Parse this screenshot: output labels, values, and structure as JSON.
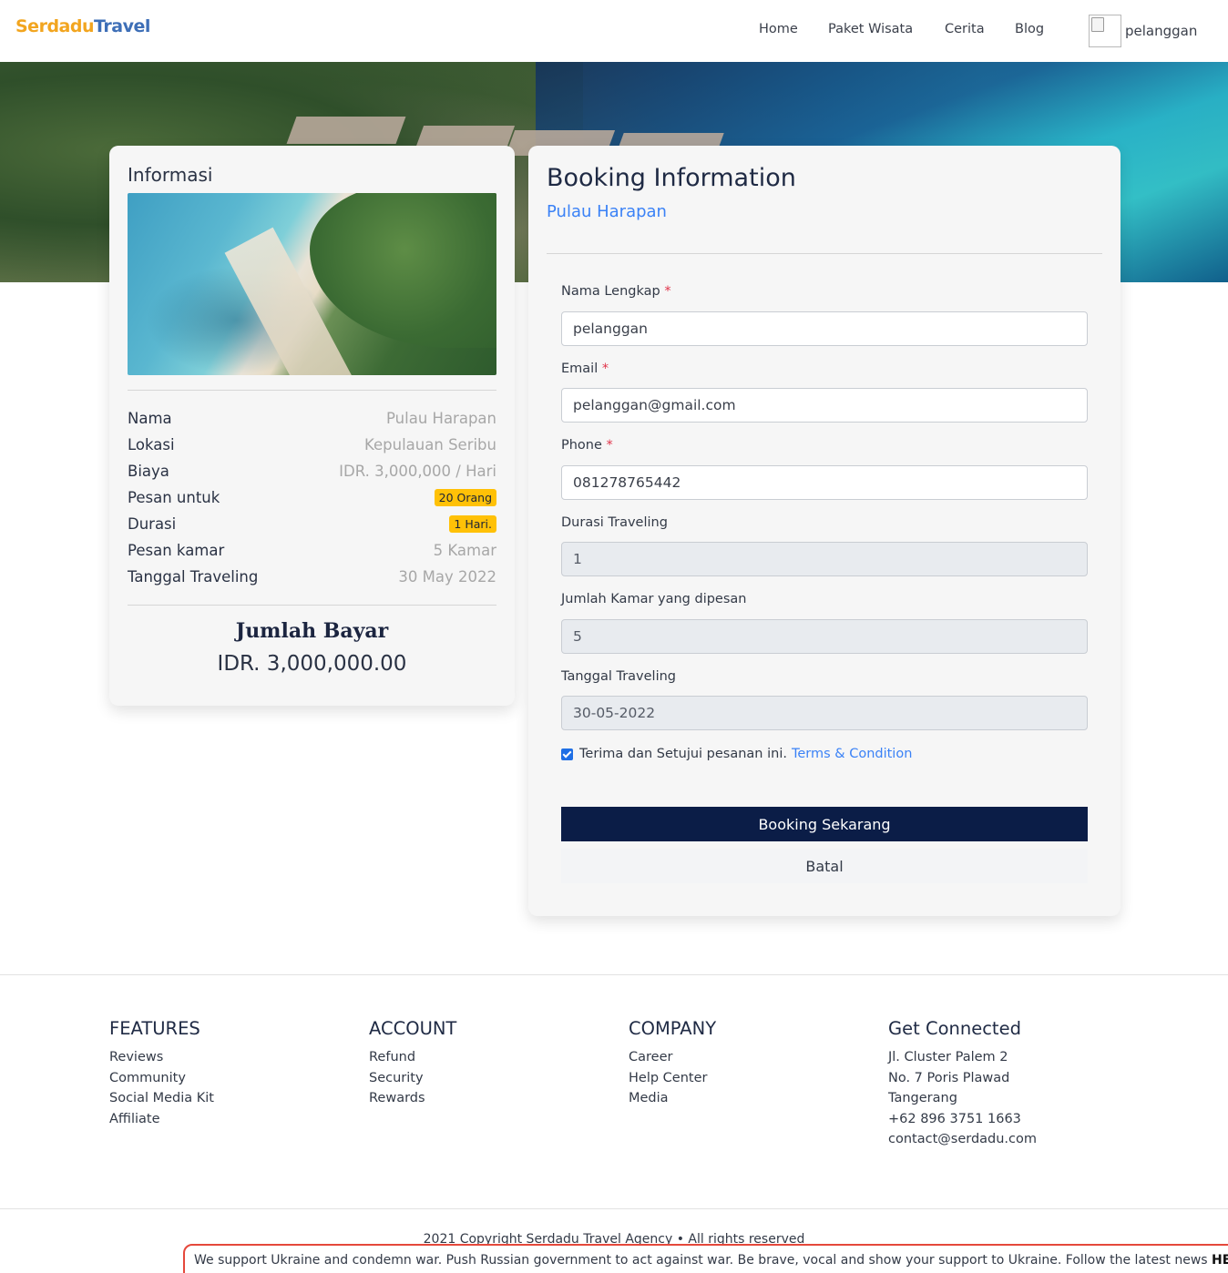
{
  "brand": {
    "part1": "Serdadu",
    "part2": "Travel"
  },
  "nav": {
    "links": [
      "Home",
      "Paket Wisata",
      "Cerita",
      "Blog"
    ],
    "user": "pelanggan"
  },
  "info": {
    "title": "Informasi",
    "rows": [
      {
        "label": "Nama",
        "value": "Pulau Harapan"
      },
      {
        "label": "Lokasi",
        "value": "Kepulauan Seribu"
      },
      {
        "label": "Biaya",
        "value": "IDR. 3,000,000 / Hari"
      },
      {
        "label": "Pesan untuk",
        "value": "20 Orang"
      },
      {
        "label": "Durasi",
        "value": "1 Hari."
      },
      {
        "label": "Pesan kamar",
        "value": "5 Kamar"
      },
      {
        "label": "Tanggal Traveling",
        "value": "30 May 2022"
      }
    ],
    "pay_title": "Jumlah Bayar",
    "pay_amount": "IDR. 3,000,000.00"
  },
  "booking": {
    "title": "Booking Information",
    "destination": "Pulau Harapan",
    "fields": {
      "name": {
        "label": "Nama Lengkap",
        "value": "pelanggan"
      },
      "email": {
        "label": "Email",
        "value": "pelanggan@gmail.com"
      },
      "phone": {
        "label": "Phone",
        "value": "081278765442"
      },
      "duration": {
        "label": "Durasi Traveling",
        "value": "1"
      },
      "rooms": {
        "label": "Jumlah Kamar yang dipesan",
        "value": "5"
      },
      "date": {
        "label": "Tanggal Traveling",
        "value": "30-05-2022"
      }
    },
    "required_mark": "*",
    "agree_text": "Terima dan Setujui pesanan ini.",
    "terms_link": "Terms & Condition",
    "submit_label": "Booking Sekarang",
    "cancel_label": "Batal"
  },
  "footer": {
    "features": {
      "title": "FEATURES",
      "links": [
        "Reviews",
        "Community",
        "Social Media Kit",
        "Affiliate"
      ]
    },
    "account": {
      "title": "ACCOUNT",
      "links": [
        "Refund",
        "Security",
        "Rewards"
      ]
    },
    "company": {
      "title": "COMPANY",
      "links": [
        "Career",
        "Help Center",
        "Media"
      ]
    },
    "connected": {
      "title": "Get Connected",
      "lines": [
        "Jl. Cluster Palem 2",
        "No. 7 Poris Plawad",
        "Tangerang",
        "+62 896 3751 1663",
        "contact@serdadu.com"
      ]
    },
    "copyright": "2021 Copyright Serdadu Travel Agency • All rights reserved"
  },
  "banner": {
    "text": "We support Ukraine and condemn war. Push Russian government to act against war. Be brave, vocal and show your support to Ukraine. Follow the latest news",
    "link": "HERE"
  },
  "colors": {
    "primary_navy": "#0b1d47",
    "link_blue": "#3b82f6",
    "badge_yellow": "#ffc107",
    "brand_orange": "#f2a51f",
    "brand_blue": "#3e6fb7",
    "required_red": "#e0344a"
  },
  "icons": {
    "avatar": "broken-image-icon",
    "checkbox": "checkbox-checked-icon"
  }
}
